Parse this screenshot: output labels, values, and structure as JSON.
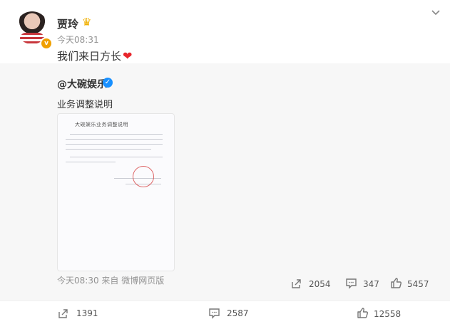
{
  "post": {
    "author": "贾玲",
    "time": "今天08:31",
    "text": "我们来日方长",
    "heart": "❤"
  },
  "repost": {
    "author": "@大碗娱乐",
    "text": "业务调整说明",
    "doc_title": "大碗娱乐业务调整说明",
    "meta": "今天08:30 来自 微博网页版",
    "reposts": "2054",
    "comments": "347",
    "likes": "5457"
  },
  "actions": {
    "reposts": "1391",
    "comments": "2587",
    "likes": "12558"
  },
  "colors": {
    "heart": "#e8262c",
    "verified_blue": "#1890ff",
    "verified_orange": "#f0a000",
    "muted_text": "#939393",
    "repost_bg": "#f7f7f7"
  },
  "icons": [
    "crown-icon",
    "chevron-down-icon",
    "verified-icon",
    "share-icon",
    "comment-icon",
    "like-icon"
  ]
}
